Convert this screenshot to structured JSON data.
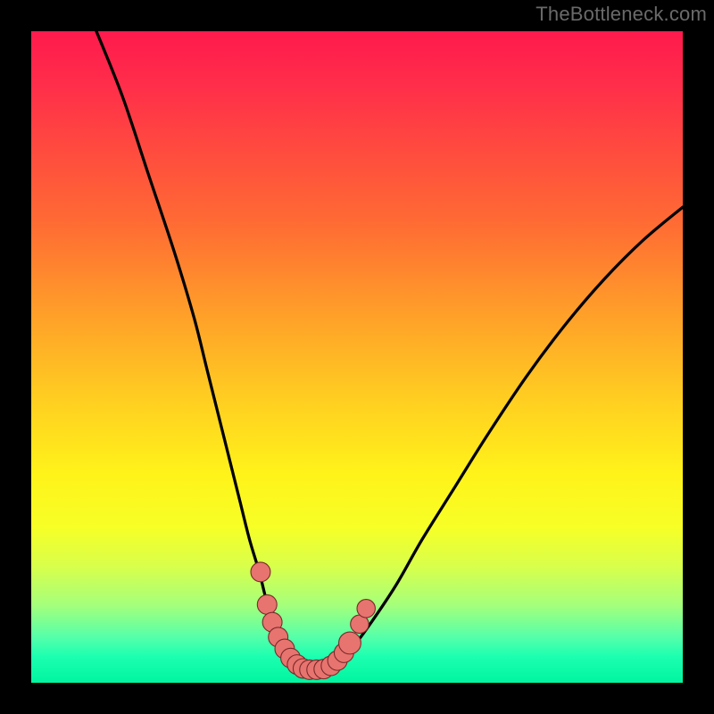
{
  "watermark": "TheBottleneck.com",
  "colors": {
    "background": "#000000",
    "gradient_top": "#ff1a4d",
    "gradient_mid": "#fff31a",
    "gradient_bottom": "#00f5a0",
    "curve": "#000000",
    "marker_fill": "#e7746f",
    "marker_stroke": "#7a2a2a"
  },
  "chart_data": {
    "type": "line",
    "title": "",
    "xlabel": "",
    "ylabel": "",
    "xlim": [
      0,
      100
    ],
    "ylim": [
      0,
      100
    ],
    "grid": false,
    "legend": false,
    "series": [
      {
        "name": "curve",
        "x": [
          10,
          14,
          18,
          22,
          25,
          27,
          29,
          30.5,
          32,
          33.5,
          35,
          36,
          37,
          38,
          39,
          40,
          41,
          42,
          43,
          44,
          45.5,
          47,
          49,
          52,
          56,
          60,
          65,
          70,
          76,
          82,
          88,
          94,
          100
        ],
        "y": [
          100,
          90,
          78,
          66,
          56,
          48,
          40,
          34,
          28,
          22,
          17,
          13,
          10,
          7.5,
          5.5,
          4,
          3,
          2.3,
          2,
          2,
          2.2,
          3,
          5,
          9,
          15,
          22,
          30,
          38,
          47,
          55,
          62,
          68,
          73
        ]
      }
    ],
    "markers": [
      {
        "x": 35.2,
        "y": 17.0,
        "r": 1.5
      },
      {
        "x": 36.2,
        "y": 12.0,
        "r": 1.5
      },
      {
        "x": 37.0,
        "y": 9.3,
        "r": 1.5
      },
      {
        "x": 37.9,
        "y": 7.0,
        "r": 1.5
      },
      {
        "x": 38.9,
        "y": 5.2,
        "r": 1.5
      },
      {
        "x": 39.8,
        "y": 3.8,
        "r": 1.5
      },
      {
        "x": 40.8,
        "y": 2.8,
        "r": 1.5
      },
      {
        "x": 41.7,
        "y": 2.2,
        "r": 1.5
      },
      {
        "x": 42.7,
        "y": 2.0,
        "r": 1.5
      },
      {
        "x": 43.8,
        "y": 2.0,
        "r": 1.5
      },
      {
        "x": 44.9,
        "y": 2.1,
        "r": 1.5
      },
      {
        "x": 46.0,
        "y": 2.6,
        "r": 1.5
      },
      {
        "x": 47.0,
        "y": 3.4,
        "r": 1.5
      },
      {
        "x": 48.0,
        "y": 4.6,
        "r": 1.5
      },
      {
        "x": 48.9,
        "y": 6.1,
        "r": 1.7
      },
      {
        "x": 50.4,
        "y": 9.0,
        "r": 1.4
      },
      {
        "x": 51.4,
        "y": 11.4,
        "r": 1.4
      }
    ]
  }
}
